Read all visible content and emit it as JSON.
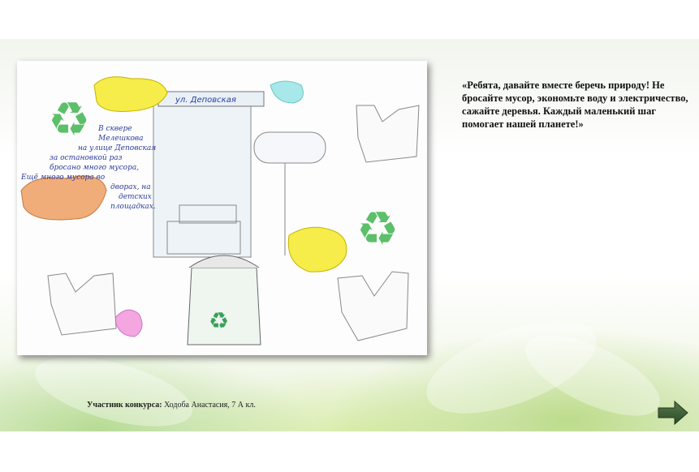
{
  "slide": {
    "quote": "«Ребята, давайте вместе беречь природу! Не бросайте мусор, экономьте воду и электричество,  сажайте деревья. Каждый маленький шаг помогает нашей планете!»",
    "credit_label": "Участник конкурса:",
    "credit_name": "Ходоба Анастасия, 7 А кл."
  },
  "drawing": {
    "street_sign": "ул. Деповская",
    "handwritten_note": [
      "В сквере",
      "Мелешкова",
      "на улице Деповская",
      "за остановкой раз",
      "бросано много мусора,",
      "Ещё много мусора во",
      "дворах, на",
      "детских",
      "площадках."
    ]
  },
  "navigation": {
    "next_icon": "arrow-right-icon"
  },
  "colors": {
    "accent_green": "#7cbf4a",
    "arrow_fill": "#3f5f3a"
  }
}
